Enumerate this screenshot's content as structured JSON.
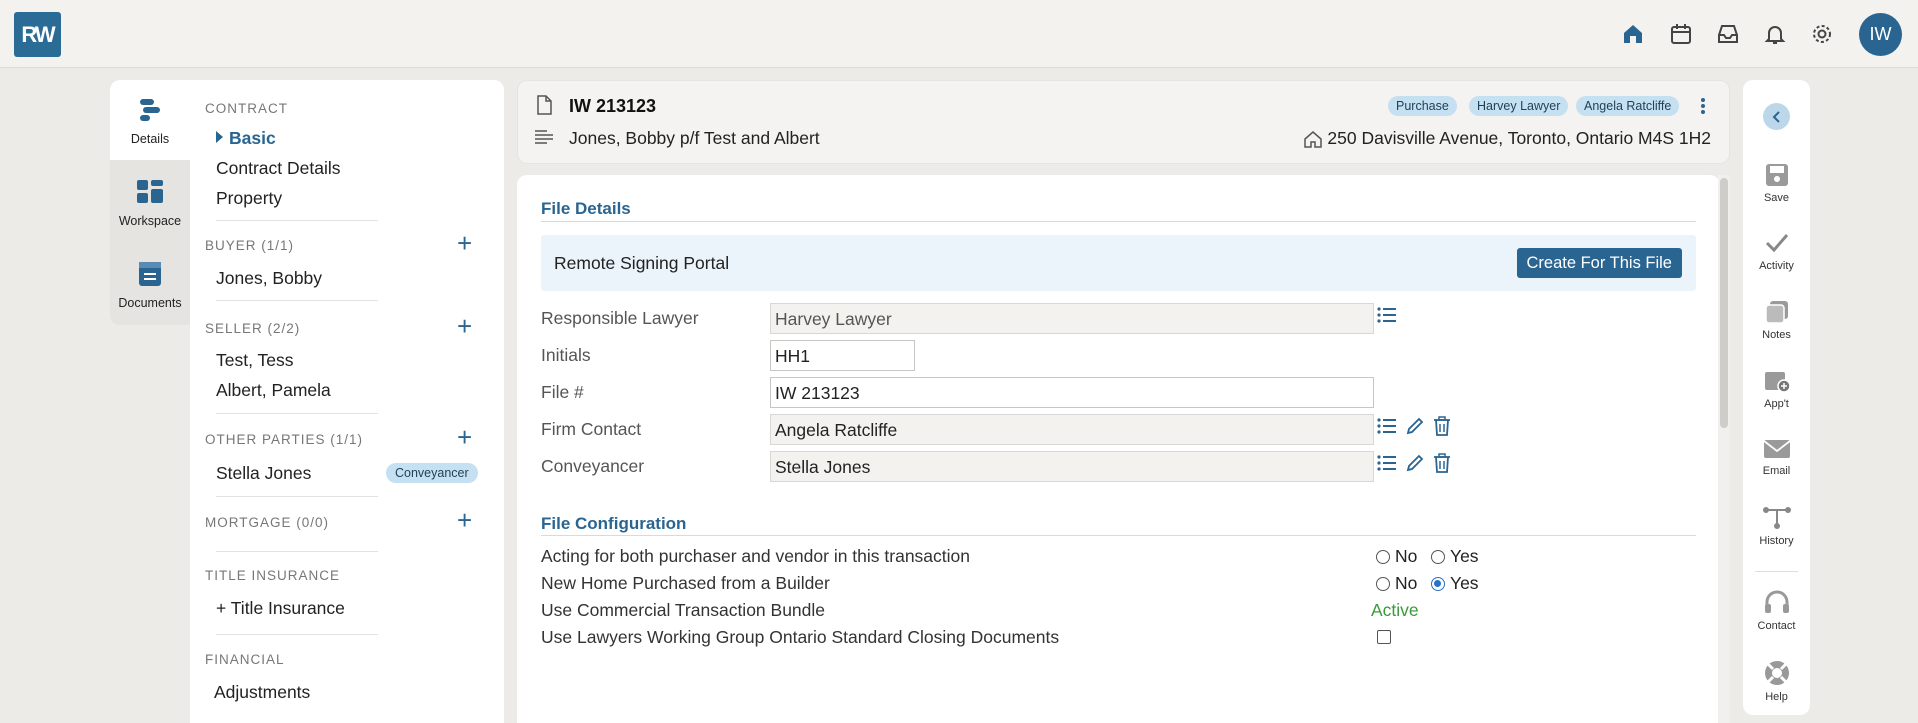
{
  "app": {
    "logo_text": "RW",
    "user_initials": "IW"
  },
  "left_tabs": [
    {
      "label": "Details",
      "icon": "details-icon"
    },
    {
      "label": "Workspace",
      "icon": "workspace-icon"
    },
    {
      "label": "Documents",
      "icon": "documents-icon"
    }
  ],
  "sidenav": {
    "contract": {
      "heading": "CONTRACT",
      "selected": "Basic",
      "items": [
        "Contract Details",
        "Property"
      ]
    },
    "buyer": {
      "heading": "BUYER (1/1)",
      "items": [
        "Jones, Bobby"
      ]
    },
    "seller": {
      "heading": "SELLER (2/2)",
      "items": [
        "Test, Tess",
        "Albert, Pamela"
      ]
    },
    "other": {
      "heading": "OTHER PARTIES (1/1)",
      "items": [
        "Stella Jones"
      ],
      "badge": "Conveyancer"
    },
    "mortgage": {
      "heading": "MORTGAGE (0/0)"
    },
    "title_ins": {
      "heading": "TITLE INSURANCE",
      "items": [
        "+ Title Insurance"
      ]
    },
    "financial": {
      "heading": "FINANCIAL",
      "items": [
        "Adjustments"
      ]
    }
  },
  "header": {
    "file_number": "IW 213123",
    "subtitle": "Jones, Bobby p/f Test and Albert",
    "address": "250 Davisville Avenue, Toronto, Ontario M4S 1H2",
    "tags": [
      "Purchase",
      "Harvey Lawyer",
      "Angela Ratcliffe"
    ]
  },
  "file_details": {
    "title": "File Details",
    "portal_label": "Remote Signing Portal",
    "portal_button": "Create For This File",
    "fields": [
      {
        "label": "Responsible Lawyer",
        "value": "Harvey Lawyer"
      },
      {
        "label": "Initials",
        "value": "HH1"
      },
      {
        "label": "File #",
        "value": "IW 213123"
      },
      {
        "label": "Firm Contact",
        "value": "Angela Ratcliffe"
      },
      {
        "label": "Conveyancer",
        "value": "Stella Jones"
      }
    ]
  },
  "file_config": {
    "title": "File Configuration",
    "rows": [
      {
        "label": "Acting for both purchaser and vendor in this transaction",
        "no": "No",
        "yes": "Yes",
        "selected": "none"
      },
      {
        "label": "New Home Purchased from a Builder",
        "no": "No",
        "yes": "Yes",
        "selected": "Yes"
      },
      {
        "label": "Use Commercial Transaction Bundle",
        "status": "Active"
      },
      {
        "label": "Use Lawyers Working Group Ontario Standard Closing Documents",
        "checked": false
      }
    ]
  },
  "right_bar": [
    "Save",
    "Activity",
    "Notes",
    "App't",
    "Email",
    "History",
    "Contact",
    "Help"
  ],
  "colors": {
    "accent": "#2a6592",
    "active_green": "#3a9a3a",
    "pill": "#c5e0f1"
  }
}
